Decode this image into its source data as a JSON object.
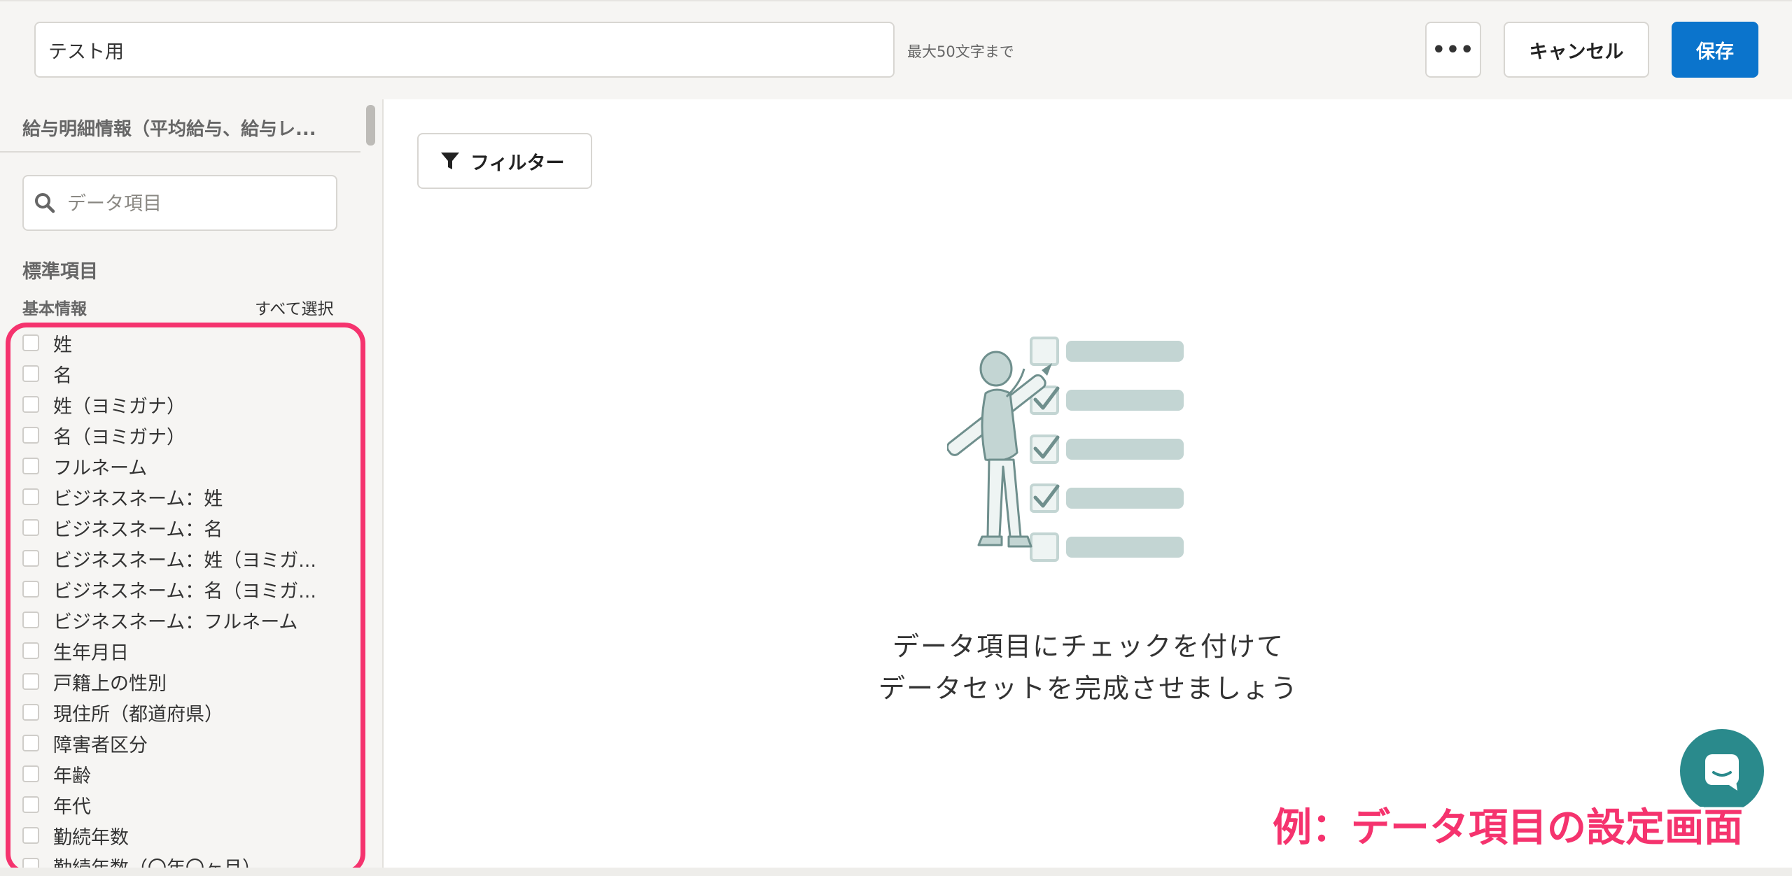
{
  "header": {
    "dataset_name": "テスト用",
    "name_hint": "最大50文字まで",
    "more_label": "•••",
    "cancel_label": "キャンセル",
    "save_label": "保存"
  },
  "sidebar": {
    "title": "給与明細情報（平均給与、給与レ...",
    "search_placeholder": "データ項目",
    "section_title": "標準項目",
    "group_title": "基本情報",
    "select_all_label": "すべて選択",
    "fields": [
      {
        "label": "姓",
        "checked": false
      },
      {
        "label": "名",
        "checked": false
      },
      {
        "label": "姓（ヨミガナ）",
        "checked": false
      },
      {
        "label": "名（ヨミガナ）",
        "checked": false
      },
      {
        "label": "フルネーム",
        "checked": false
      },
      {
        "label": "ビジネスネーム：姓",
        "checked": false
      },
      {
        "label": "ビジネスネーム：名",
        "checked": false
      },
      {
        "label": "ビジネスネーム：姓（ヨミガ...",
        "checked": false
      },
      {
        "label": "ビジネスネーム：名（ヨミガ...",
        "checked": false
      },
      {
        "label": "ビジネスネーム：フルネーム",
        "checked": false
      },
      {
        "label": "生年月日",
        "checked": false
      },
      {
        "label": "戸籍上の性別",
        "checked": false
      },
      {
        "label": "現住所（都道府県）",
        "checked": false
      },
      {
        "label": "障害者区分",
        "checked": false
      },
      {
        "label": "年齢",
        "checked": false
      },
      {
        "label": "年代",
        "checked": false
      },
      {
        "label": "勤続年数",
        "checked": false
      },
      {
        "label": "勤続年数（〇年〇ヶ月）",
        "checked": false
      }
    ]
  },
  "main": {
    "filter_label": "フィルター",
    "empty_line1": "データ項目にチェックを付けて",
    "empty_line2": "データセットを完成させましょう"
  },
  "caption": "例：データ項目の設定画面",
  "colors": {
    "primary": "#0b74cc",
    "highlight": "#f5336e",
    "chat": "#2a8a8c",
    "illustration": "#c3d5d3"
  },
  "icons": {
    "search": "search-icon",
    "filter": "filter-icon",
    "chat": "chat-icon"
  }
}
